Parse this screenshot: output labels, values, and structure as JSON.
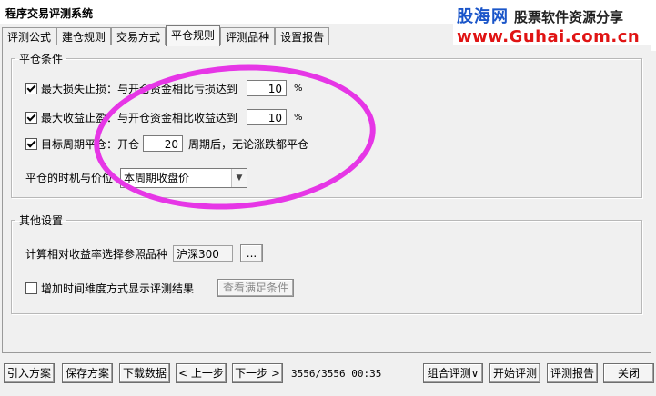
{
  "window": {
    "title": "程序交易评测系统"
  },
  "logo": {
    "brand": "股海网",
    "slogan": "股票软件资源分享",
    "url": "www.Guhai.com.cn"
  },
  "tabs": [
    {
      "label": "评测公式"
    },
    {
      "label": "建仓规则"
    },
    {
      "label": "交易方式"
    },
    {
      "label": "平仓规则",
      "active": true
    },
    {
      "label": "评测品种"
    },
    {
      "label": "设置报告"
    }
  ],
  "close_conditions": {
    "legend": "平仓条件",
    "max_loss": {
      "label": "最大损失止损：与开仓资金相比亏损达到",
      "checked": true,
      "value": "10",
      "unit": "%"
    },
    "max_gain": {
      "label": "最大收益止盈：与开仓资金相比收益达到",
      "checked": true,
      "value": "10",
      "unit": "%"
    },
    "target_period": {
      "label": "目标周期平仓：开仓",
      "checked": true,
      "value": "20",
      "suffix": "周期后，无论涨跌都平仓"
    },
    "timing": {
      "label": "平仓的时机与价位",
      "selected": "本周期收盘价"
    }
  },
  "other_settings": {
    "legend": "其他设置",
    "ref_instrument": {
      "label": "计算相对收益率选择参照品种",
      "value": "沪深300",
      "browse": "..."
    },
    "time_dimension": {
      "label": "增加时间维度方式显示评测结果",
      "checked": false,
      "button": "查看满足条件"
    }
  },
  "bottom": {
    "import": "引入方案",
    "save": "保存方案",
    "download": "下载数据",
    "prev": "< 上一步",
    "next": "下一步 >",
    "status": "3556/3556 00:35",
    "combo": "组合评测∨",
    "start": "开始评测",
    "report": "评测报告",
    "close": "关闭"
  },
  "colors": {
    "annotation": "#e636e6",
    "logo_blue": "#1a55c9",
    "logo_red": "#e01414"
  }
}
